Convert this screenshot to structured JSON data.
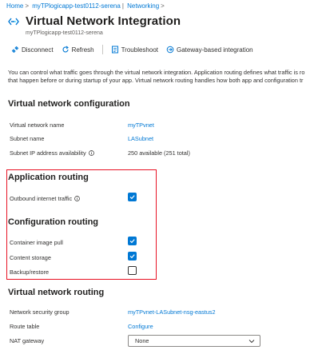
{
  "breadcrumb": {
    "home": "Home",
    "resource": "myTPlogicapp-test0112-serena",
    "page": "Networking"
  },
  "header": {
    "title": "Virtual Network Integration",
    "subtitle": "myTPlogicapp-test0112-serena"
  },
  "toolbar": {
    "disconnect": "Disconnect",
    "refresh": "Refresh",
    "troubleshoot": "Troubleshoot",
    "gateway": "Gateway-based integration"
  },
  "description": {
    "line1": "You can control what traffic goes through the virtual network integration. Application routing defines what traffic is ro",
    "line2": "that happen before or during startup of your app. Virtual network routing handles how both app and configuration tr"
  },
  "vnet_config": {
    "title": "Virtual network configuration",
    "vnet_name_label": "Virtual network name",
    "vnet_name_value": "myTPvnet",
    "subnet_name_label": "Subnet name",
    "subnet_name_value": "LASubnet",
    "subnet_ip_label": "Subnet IP address availability",
    "subnet_ip_value": "250 available (251 total)"
  },
  "app_routing": {
    "title": "Application routing",
    "outbound_label": "Outbound internet traffic",
    "outbound_checked": true
  },
  "config_routing": {
    "title": "Configuration routing",
    "container_label": "Container image pull",
    "container_checked": true,
    "content_label": "Content storage",
    "content_checked": true,
    "backup_label": "Backup/restore",
    "backup_checked": false
  },
  "vnet_routing": {
    "title": "Virtual network routing",
    "nsg_label": "Network security group",
    "nsg_value": "myTPvnet-LASubnet-nsg-eastus2",
    "route_label": "Route table",
    "route_value": "Configure",
    "nat_label": "NAT gateway",
    "nat_value": "None"
  },
  "colors": {
    "accent": "#0078d4",
    "highlight_border": "#e81123"
  }
}
